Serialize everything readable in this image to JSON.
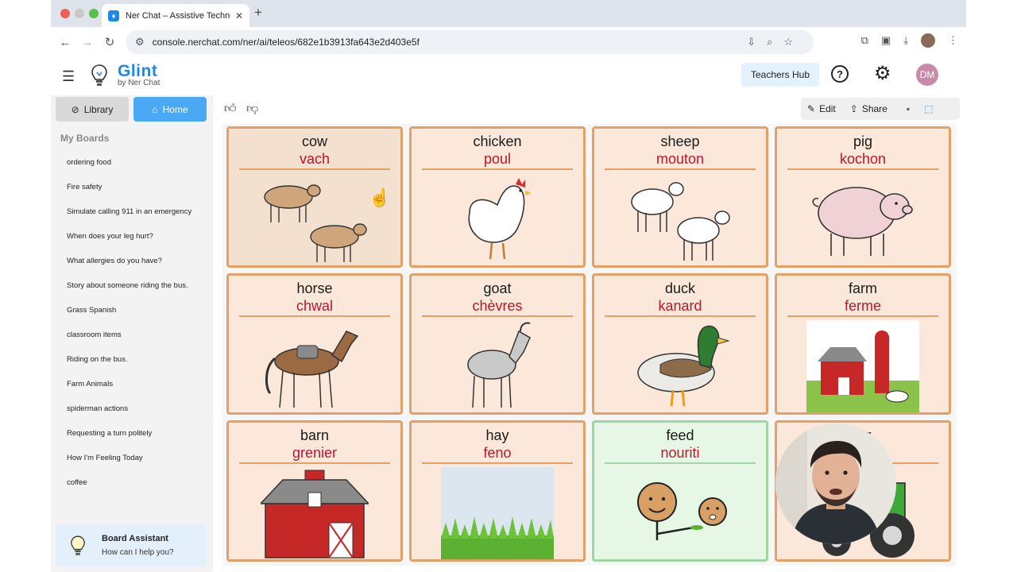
{
  "browser": {
    "tab_title": "Ner Chat – Assistive Technolo",
    "url": "console.nerchat.com/ner/ai/teleos/682e1b3913fa643e2d403e5f"
  },
  "header": {
    "brand": "Glint",
    "sub_brand": "by Ner Chat",
    "teachers_hub": "Teachers Hub",
    "avatar_initials": "DM"
  },
  "sidebar": {
    "library": "Library",
    "home": "Home",
    "my_boards": "My Boards",
    "boards": [
      "ordering food",
      "Fire safety",
      "Simulate calling 911 in an emergency",
      "When does your leg hurt?",
      "What allergies do you have?",
      "Story about someone riding the bus.",
      "Grass Spanish",
      "classroom items",
      "Riding on the bus.",
      "Farm Animals",
      "spiderman actions",
      "Requesting a turn politely",
      "How I'm Feeling Today",
      "coffee"
    ],
    "assistant_title": "Board Assistant",
    "assistant_sub": "How can I help you?"
  },
  "grid_toolbar": {
    "edit": "Edit",
    "share": "Share"
  },
  "cards": [
    {
      "en": "cow",
      "tr": "vach",
      "icon": "cow-icon"
    },
    {
      "en": "chicken",
      "tr": "poul",
      "icon": "chicken-icon"
    },
    {
      "en": "sheep",
      "tr": "mouton",
      "icon": "sheep-icon"
    },
    {
      "en": "pig",
      "tr": "kochon",
      "icon": "pig-icon"
    },
    {
      "en": "horse",
      "tr": "chwal",
      "icon": "horse-icon"
    },
    {
      "en": "goat",
      "tr": "chèvres",
      "icon": "goat-icon"
    },
    {
      "en": "duck",
      "tr": "kanard",
      "icon": "duck-icon"
    },
    {
      "en": "farm",
      "tr": "ferme",
      "icon": "farm-icon"
    },
    {
      "en": "barn",
      "tr": "grenier",
      "icon": "barn-icon"
    },
    {
      "en": "hay",
      "tr": "feno",
      "icon": "hay-icon"
    },
    {
      "en": "feed",
      "tr": "nouriti",
      "icon": "feed-icon"
    },
    {
      "en": "tor",
      "tr": "",
      "icon": "tractor-icon"
    }
  ]
}
